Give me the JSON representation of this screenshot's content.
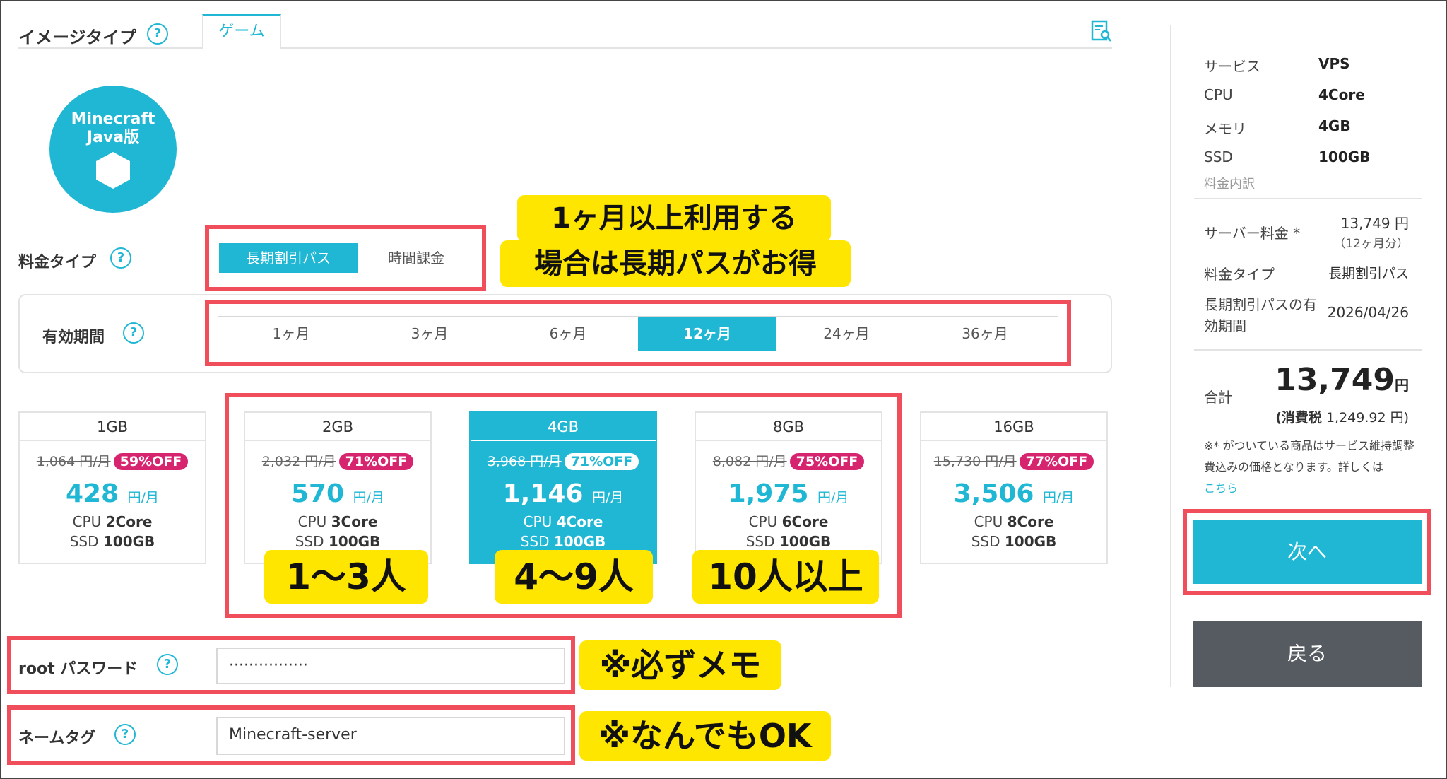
{
  "header": {
    "image_type_label": "イメージタイプ",
    "tab_game": "ゲーム",
    "help_glyph": "?"
  },
  "logo": {
    "line1": "Minecraft",
    "line2": "Java版"
  },
  "price_type": {
    "label": "料金タイプ",
    "options": [
      "長期割引パス",
      "時間課金"
    ],
    "selected": "長期割引パス"
  },
  "period": {
    "label": "有効期間",
    "options": [
      "1ヶ月",
      "3ヶ月",
      "6ヶ月",
      "12ヶ月",
      "24ヶ月",
      "36ヶ月"
    ],
    "selected": "12ヶ月"
  },
  "plans": [
    {
      "memory": "1GB",
      "old_price": "1,064 円/月",
      "discount": "59%OFF",
      "price": "428",
      "unit": "円/月",
      "cpu_label": "CPU",
      "cpu": "2Core",
      "ssd_label": "SSD",
      "ssd": "100GB"
    },
    {
      "memory": "2GB",
      "old_price": "2,032 円/月",
      "discount": "71%OFF",
      "price": "570",
      "unit": "円/月",
      "cpu_label": "CPU",
      "cpu": "3Core",
      "ssd_label": "SSD",
      "ssd": "100GB"
    },
    {
      "memory": "4GB",
      "old_price": "3,968 円/月",
      "discount": "71%OFF",
      "price": "1,146",
      "unit": "円/月",
      "cpu_label": "CPU",
      "cpu": "4Core",
      "ssd_label": "SSD",
      "ssd": "100GB"
    },
    {
      "memory": "8GB",
      "old_price": "8,082 円/月",
      "discount": "75%OFF",
      "price": "1,975",
      "unit": "円/月",
      "cpu_label": "CPU",
      "cpu": "6Core",
      "ssd_label": "SSD",
      "ssd": "100GB"
    },
    {
      "memory": "16GB",
      "old_price": "15,730 円/月",
      "discount": "77%OFF",
      "price": "3,506",
      "unit": "円/月",
      "cpu_label": "CPU",
      "cpu": "8Core",
      "ssd_label": "SSD",
      "ssd": "100GB"
    }
  ],
  "root_password": {
    "label": "root パスワード",
    "value": "················"
  },
  "name_tag": {
    "label": "ネームタグ",
    "value": "Minecraft-server"
  },
  "summary": {
    "service_k": "サービス",
    "service_v": "VPS",
    "cpu_k": "CPU",
    "cpu_v": "4Core",
    "memory_k": "メモリ",
    "memory_v": "4GB",
    "ssd_k": "SSD",
    "ssd_v": "100GB",
    "breakdown_label": "料金内訳",
    "server_fee_k": "サーバー料金 *",
    "server_fee_v": "13,749 円",
    "server_fee_sub": "（12ヶ月分）",
    "price_type_k": "料金タイプ",
    "price_type_v": "長期割引パス",
    "expiry_k": "長期割引パスの有効期間",
    "expiry_v": "2026/04/26",
    "total_k": "合計",
    "total_v": "13,749",
    "total_unit": "円",
    "tax_label": "(消費税",
    "tax_v": "1,249.92 円)",
    "note": "※* がついている商品はサービス維持調整費込みの価格となります。詳しくは",
    "note_link": "こちら",
    "next_button": "次へ",
    "back_button": "戻る"
  },
  "annotations": {
    "long_term_line1": "1ヶ月以上利用する",
    "long_term_line2": "場合は長期パスがお得",
    "players_small": "1～3人",
    "players_mid": "4～9人",
    "players_large": "10人以上",
    "memo_note": "※必ずメモ",
    "any_ok_note": "※なんでもOK"
  },
  "colors": {
    "accent": "#1fb7d4",
    "discount_badge": "#d6246e",
    "highlight_box": "#f04e5a",
    "callout": "#ffe600",
    "back_button": "#555b60"
  }
}
